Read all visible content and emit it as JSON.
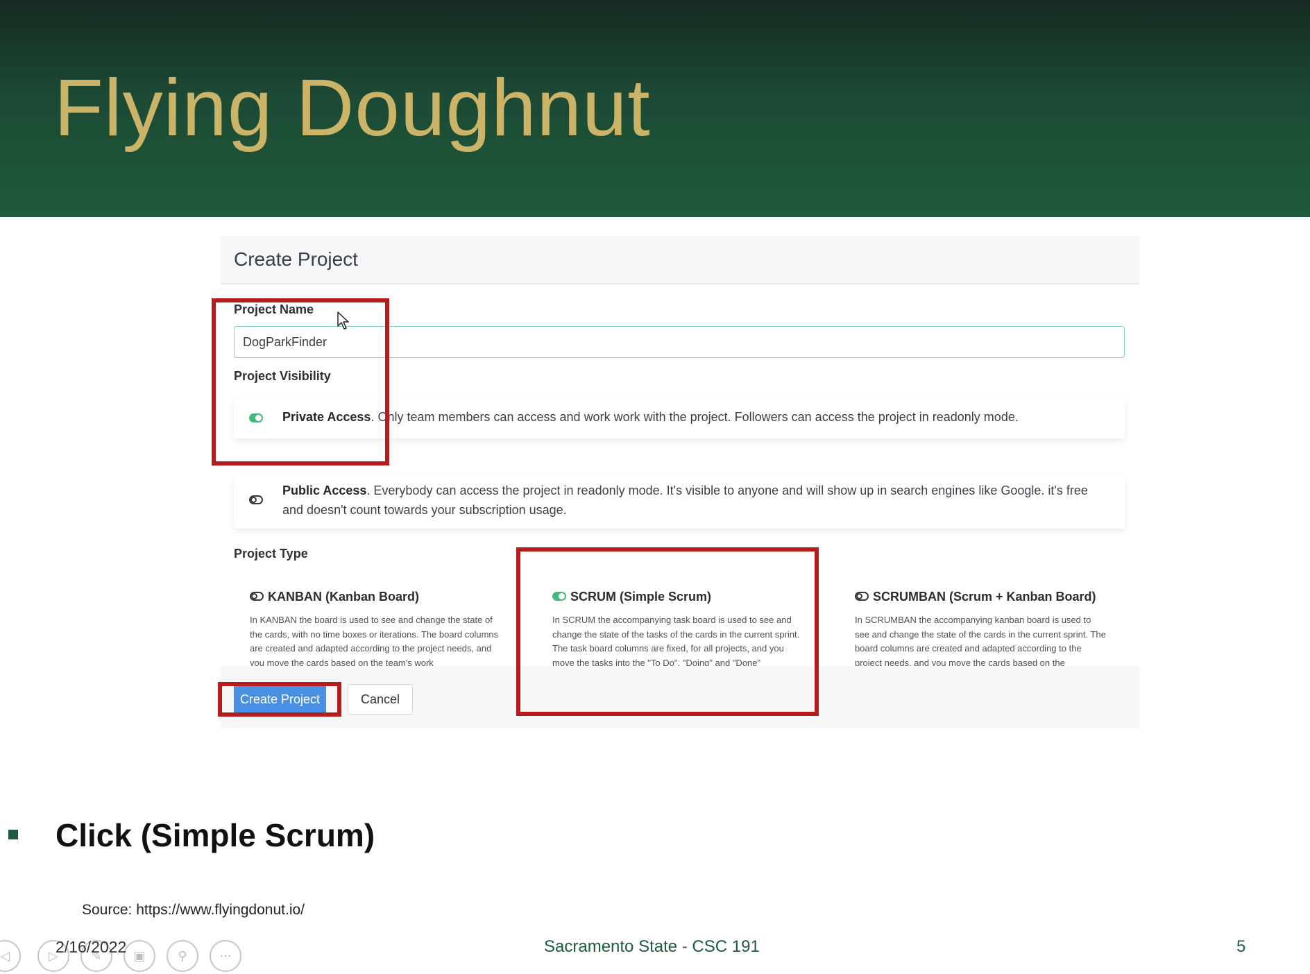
{
  "slide": {
    "title": "Flying Doughnut",
    "bullet": "Click (Simple Scrum)",
    "source": "Source: https://www.flyingdonut.io/",
    "footer": {
      "date": "2/16/2022",
      "course": "Sacramento State - CSC 191",
      "page": "5"
    },
    "colors": {
      "header_bg": "#1c4a34",
      "title": "#cbb468",
      "highlight": "#b51d1d"
    }
  },
  "form": {
    "heading": "Create Project",
    "project_name_label": "Project Name",
    "project_name_value": "DogParkFinder",
    "visibility_label": "Project Visibility",
    "visibility_options": [
      {
        "title": "Private Access",
        "text": ". Only team members can access and work work with the project. Followers can access the project in readonly mode.",
        "selected": true
      },
      {
        "title": "Public Access",
        "text": ". Everybody can access the project in readonly mode. It's visible to anyone and will show up in search engines like Google. it's free and doesn't count towards your subscription usage.",
        "selected": false
      }
    ],
    "type_label": "Project Type",
    "types": [
      {
        "title": "KANBAN (Kanban Board)",
        "desc": "In KANBAN the board is used to see and change the state of the cards, with no time boxes or iterations. The board columns are created and adapted according to the project needs, and you move the cards based on the team's work",
        "selected": false
      },
      {
        "title": "SCRUM (Simple Scrum)",
        "desc": "In SCRUM the accompanying task board is used to see and change the state of the tasks of the cards in the current sprint. The task board columns are fixed, for all projects, and you move the tasks into the \"To Do\", \"Doing\" and \"Done\"",
        "selected": true
      },
      {
        "title": "SCRUMBAN (Scrum + Kanban Board)",
        "desc": "In SCRUMBAN the accompanying kanban board is used to see and change the state of the cards in the current sprint. The board columns are created and adapted according to the project needs, and you move the cards based on the",
        "selected": false
      }
    ],
    "create_button": "Create Project",
    "cancel_button": "Cancel"
  },
  "controls": {
    "icons": [
      "previous-icon",
      "play-icon",
      "pen-icon",
      "slides-icon",
      "zoom-icon",
      "more-icon"
    ]
  }
}
